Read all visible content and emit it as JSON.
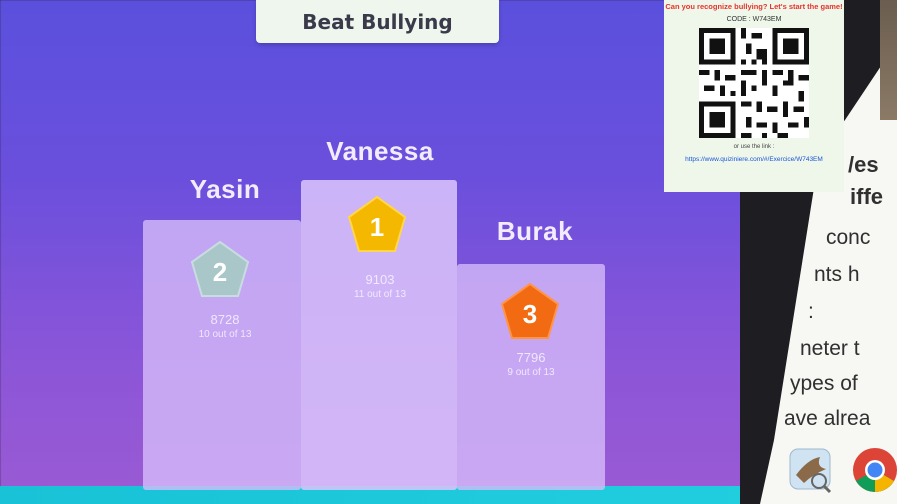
{
  "title": "Beat Bullying",
  "podium": [
    {
      "rank": "2",
      "name": "Yasin",
      "score": "8728",
      "detail": "10 out of 13",
      "color": "#a9c6c9"
    },
    {
      "rank": "1",
      "name": "Vanessa",
      "score": "9103",
      "detail": "11 out of 13",
      "color": "#f5b800"
    },
    {
      "rank": "3",
      "name": "Burak",
      "score": "7796",
      "detail": "9 out of 13",
      "color": "#f26a12"
    }
  ],
  "qr_card": {
    "headline": "Can you recognize bullying? Let's start the game!",
    "code_label": "CODE : W743EM",
    "or_text": "or use the link :",
    "link": "https://www.quiziniere.com/#/Exercice/W743EM"
  },
  "document_fragments": [
    "/es",
    "iffe",
    "conc",
    "nts h",
    ":",
    "neter t",
    "ypes of",
    "ave alrea"
  ],
  "dock": {
    "icons": [
      "preview-app-icon",
      "chrome-icon"
    ]
  }
}
